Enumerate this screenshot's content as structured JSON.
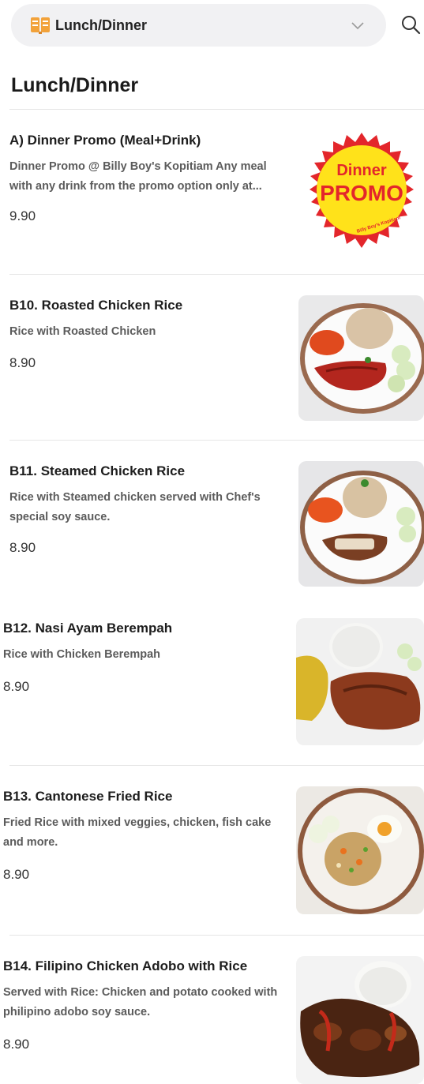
{
  "header": {
    "category_label": "Lunch/Dinner",
    "category_icon": "menu-book-icon",
    "dropdown_icon": "chevron-down-icon",
    "search_icon": "search-icon"
  },
  "section": {
    "title": "Lunch/Dinner"
  },
  "promo_badge": {
    "line1": "Dinner",
    "line2": "PROMO",
    "small": "Billy Boy's Kopitiam"
  },
  "items": [
    {
      "name": "A) Dinner Promo (Meal+Drink)",
      "desc": "Dinner Promo @ Billy Boy's Kopitiam Any meal with any drink from the promo option only at...",
      "price": "9.90"
    },
    {
      "name": "B10. Roasted Chicken Rice",
      "desc": "Rice with Roasted Chicken",
      "price": "8.90"
    },
    {
      "name": "B11. Steamed Chicken Rice",
      "desc": "Rice with Steamed chicken served with Chef's special soy sauce.",
      "price": "8.90"
    },
    {
      "name": "B12. Nasi Ayam Berempah",
      "desc": "Rice with Chicken Berempah",
      "price": "8.90"
    },
    {
      "name": "B13. Cantonese Fried Rice",
      "desc": "Fried Rice with mixed veggies, chicken, fish cake and more.",
      "price": "8.90"
    },
    {
      "name": "B14. Filipino Chicken Adobo with Rice",
      "desc": "Served with Rice: Chicken and potato cooked with philipino adobo soy sauce.",
      "price": "8.90"
    }
  ]
}
